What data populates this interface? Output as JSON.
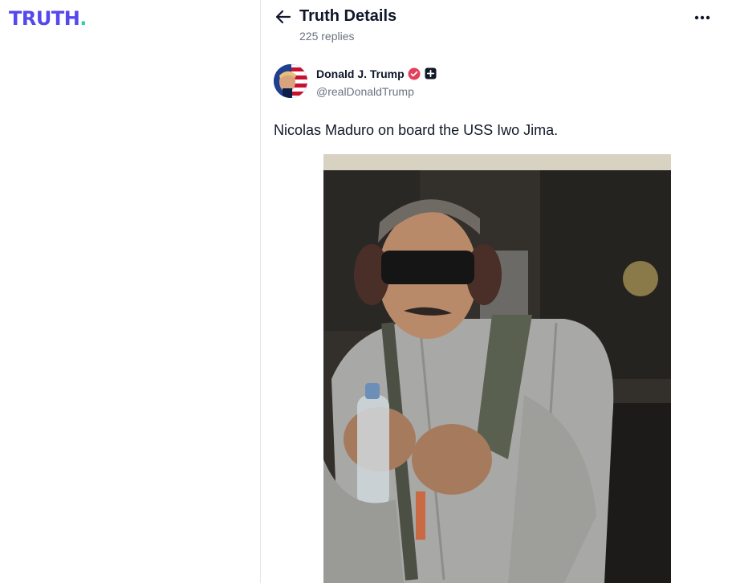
{
  "app": {
    "logo_text": "TRUTH",
    "logo_dot": ".",
    "brand_color": "#5448ee",
    "accent_color": "#2ed1a8"
  },
  "header": {
    "title": "Truth Details",
    "replies": "225 replies",
    "back_icon": "arrow-left-icon",
    "more_icon": "more-horizontal-icon"
  },
  "author": {
    "name": "Donald J. Trump",
    "handle": "@realDonaldTrump",
    "verified_color": "#e3405c"
  },
  "post": {
    "text": "Nicolas Maduro on board the USS Iwo Jima.",
    "media_type": "photo"
  }
}
